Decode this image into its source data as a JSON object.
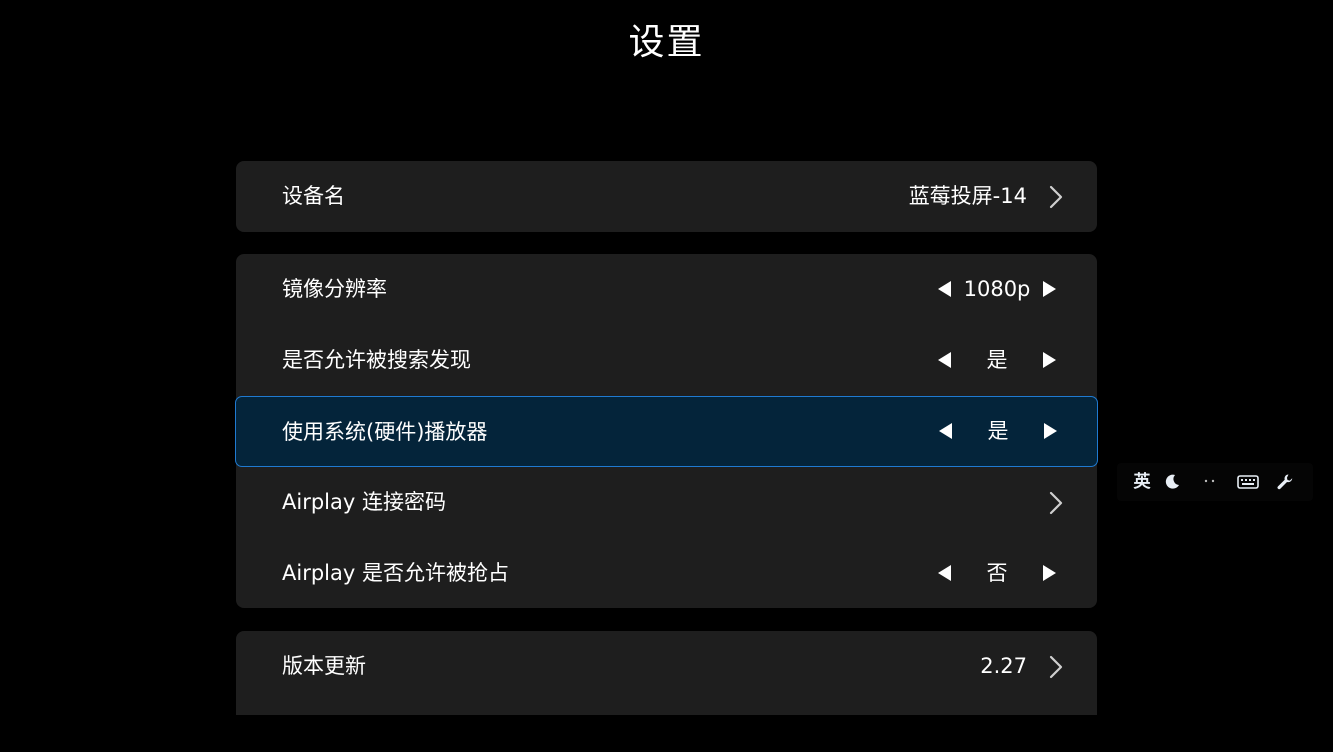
{
  "header": {
    "title": "设置"
  },
  "device_section": {
    "device_name_label": "设备名",
    "device_name_value": "蓝莓投屏-14"
  },
  "settings_section": {
    "resolution": {
      "label": "镜像分辨率",
      "value": "1080p"
    },
    "discoverable": {
      "label": "是否允许被搜索发现",
      "value": "是"
    },
    "hardware_player": {
      "label": "使用系统(硬件)播放器",
      "value": "是"
    },
    "airplay_password": {
      "label": "Airplay 连接密码"
    },
    "airplay_preempt": {
      "label": "Airplay 是否允许被抢占",
      "value": "否"
    }
  },
  "update_section": {
    "version_label": "版本更新",
    "version_value": "2.27"
  },
  "ime_toolbar": {
    "language": "英",
    "icons": [
      "moon-icon",
      "punctuation-icon",
      "keyboard-icon",
      "wrench-icon"
    ]
  },
  "colors": {
    "background": "#000000",
    "card": "#1e1e1e",
    "focused_row_bg": "#04243a",
    "focused_row_border": "#1f7ad1",
    "text": "#ffffff"
  }
}
